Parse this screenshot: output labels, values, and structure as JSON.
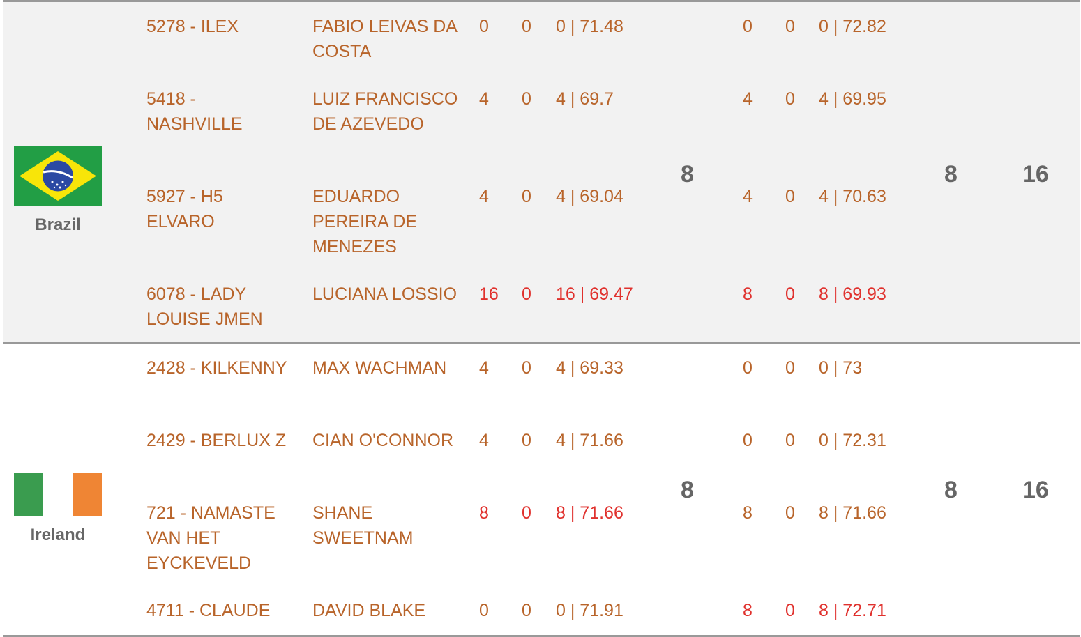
{
  "teams": [
    {
      "country": "Brazil",
      "round1_total": "8",
      "round2_total": "8",
      "overall_total": "16",
      "riders": [
        {
          "horse": "5278 - ILEX",
          "rider": "FABIO LEIVAS DA COSTA",
          "r1_faults": "0",
          "r1_time_faults": "0",
          "r1_result": "0 | 71.48",
          "r2_faults": "0",
          "r2_time_faults": "0",
          "r2_result": "0 | 72.82",
          "r1_dropped": false,
          "r2_dropped": false
        },
        {
          "horse": "5418 - NASHVILLE",
          "rider": "LUIZ FRANCISCO DE AZEVEDO",
          "r1_faults": "4",
          "r1_time_faults": "0",
          "r1_result": "4 | 69.7",
          "r2_faults": "4",
          "r2_time_faults": "0",
          "r2_result": "4 | 69.95",
          "r1_dropped": false,
          "r2_dropped": false
        },
        {
          "horse": "5927 - H5 ELVARO",
          "rider": "EDUARDO PEREIRA DE MENEZES",
          "r1_faults": "4",
          "r1_time_faults": "0",
          "r1_result": "4 | 69.04",
          "r2_faults": "4",
          "r2_time_faults": "0",
          "r2_result": "4 | 70.63",
          "r1_dropped": false,
          "r2_dropped": false
        },
        {
          "horse": "6078 - LADY LOUISE JMEN",
          "rider": "LUCIANA LOSSIO",
          "r1_faults": "16",
          "r1_time_faults": "0",
          "r1_result": "16 | 69.47",
          "r2_faults": "8",
          "r2_time_faults": "0",
          "r2_result": "8 | 69.93",
          "r1_dropped": true,
          "r2_dropped": true
        }
      ]
    },
    {
      "country": "Ireland",
      "round1_total": "8",
      "round2_total": "8",
      "overall_total": "16",
      "riders": [
        {
          "horse": "2428 - KILKENNY",
          "rider": "MAX WACHMAN",
          "r1_faults": "4",
          "r1_time_faults": "0",
          "r1_result": "4 | 69.33",
          "r2_faults": "0",
          "r2_time_faults": "0",
          "r2_result": "0 | 73",
          "r1_dropped": false,
          "r2_dropped": false
        },
        {
          "horse": "2429 - BERLUX Z",
          "rider": "CIAN O'CONNOR",
          "r1_faults": "4",
          "r1_time_faults": "0",
          "r1_result": "4 | 71.66",
          "r2_faults": "0",
          "r2_time_faults": "0",
          "r2_result": "0 | 72.31",
          "r1_dropped": false,
          "r2_dropped": false
        },
        {
          "horse": "721 - NAMASTE VAN HET EYCKEVELD",
          "rider": "SHANE SWEETNAM",
          "r1_faults": "8",
          "r1_time_faults": "0",
          "r1_result": "8 | 71.66",
          "r2_faults": "8",
          "r2_time_faults": "0",
          "r2_result": "8 | 71.66",
          "r1_dropped": true,
          "r2_dropped": false
        },
        {
          "horse": "4711 - CLAUDE",
          "rider": "DAVID BLAKE",
          "r1_faults": "0",
          "r1_time_faults": "0",
          "r1_result": "0 | 71.91",
          "r2_faults": "8",
          "r2_time_faults": "0",
          "r2_result": "8 | 72.71",
          "r1_dropped": false,
          "r2_dropped": true
        }
      ]
    }
  ],
  "colors": {
    "counting": "#b8642a",
    "dropped": "#e0312d",
    "totals": "#666666",
    "brazil_green": "#229e45",
    "brazil_yellow": "#f8e509",
    "brazil_blue": "#2b49a3",
    "ireland_green": "#3a9c4f",
    "ireland_orange": "#ef8534"
  }
}
